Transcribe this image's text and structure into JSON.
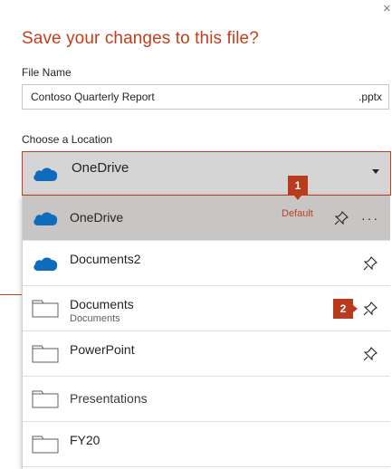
{
  "dialog": {
    "close_glyph": "×",
    "title": "Save your changes to this file?"
  },
  "file_name": {
    "label": "File Name",
    "value": "Contoso Quarterly Report",
    "extension": ".pptx"
  },
  "location": {
    "label": "Choose a Location",
    "selected": "OneDrive",
    "selected_icon": "onedrive-cloud-icon",
    "items": [
      {
        "name": "OneDrive",
        "sub": "",
        "icon": "onedrive-cloud-icon",
        "tag": "Default",
        "pinned": true,
        "more": "···"
      },
      {
        "name": "Documents2",
        "sub": "",
        "icon": "onedrive-cloud-icon",
        "pinned": true
      },
      {
        "name": "Documents",
        "sub": "Documents",
        "icon": "folder-icon",
        "pinned": true
      },
      {
        "name": "PowerPoint",
        "sub": "",
        "icon": "folder-icon",
        "pinned": true
      },
      {
        "name": "Presentations",
        "sub": "",
        "icon": "folder-icon",
        "pinned": false
      },
      {
        "name": "FY20",
        "sub": "",
        "icon": "folder-icon",
        "pinned": false
      }
    ]
  },
  "callouts": [
    {
      "number": "1"
    },
    {
      "number": "2"
    }
  ],
  "colors": {
    "accent": "#c43e1c",
    "callout": "#b83b1e",
    "onedrive_blue": "#0f6cbd",
    "selected_row": "#c8c6c4",
    "dropdown_bg": "#d5d5d5"
  }
}
